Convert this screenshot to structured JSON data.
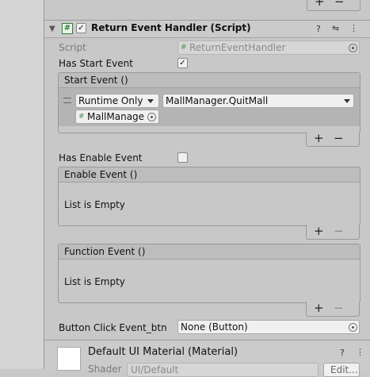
{
  "component": {
    "title": "Return Event Handler (Script)",
    "enabled": true,
    "fields": {
      "script_label": "Script",
      "script_value": "ReturnEventHandler",
      "has_start_label": "Has Start Event",
      "has_start_checked": true,
      "has_enable_label": "Has Enable Event",
      "has_enable_checked": false,
      "button_click_label": "Button Click Event_btn",
      "button_click_value": "None (Button)"
    },
    "start_event": {
      "title": "Start Event ()",
      "runtime_option": "Runtime Only",
      "function": "MallManager.QuitMall",
      "target_object": "MallManage"
    },
    "enable_event": {
      "title": "Enable Event ()",
      "empty_text": "List is Empty"
    },
    "function_event": {
      "title": "Function Event ()",
      "empty_text": "List is Empty"
    }
  },
  "next_component": {
    "title": "Default UI Material (Material)",
    "shader_label": "Shader",
    "shader_value": "UI/Default",
    "edit_label": "Edit..."
  },
  "glyphs": {
    "plus": "+",
    "minus": "−",
    "fold": "▼",
    "check": "✓",
    "hash": "#",
    "help": "?",
    "sliders": "⇋",
    "more": "⋮"
  }
}
